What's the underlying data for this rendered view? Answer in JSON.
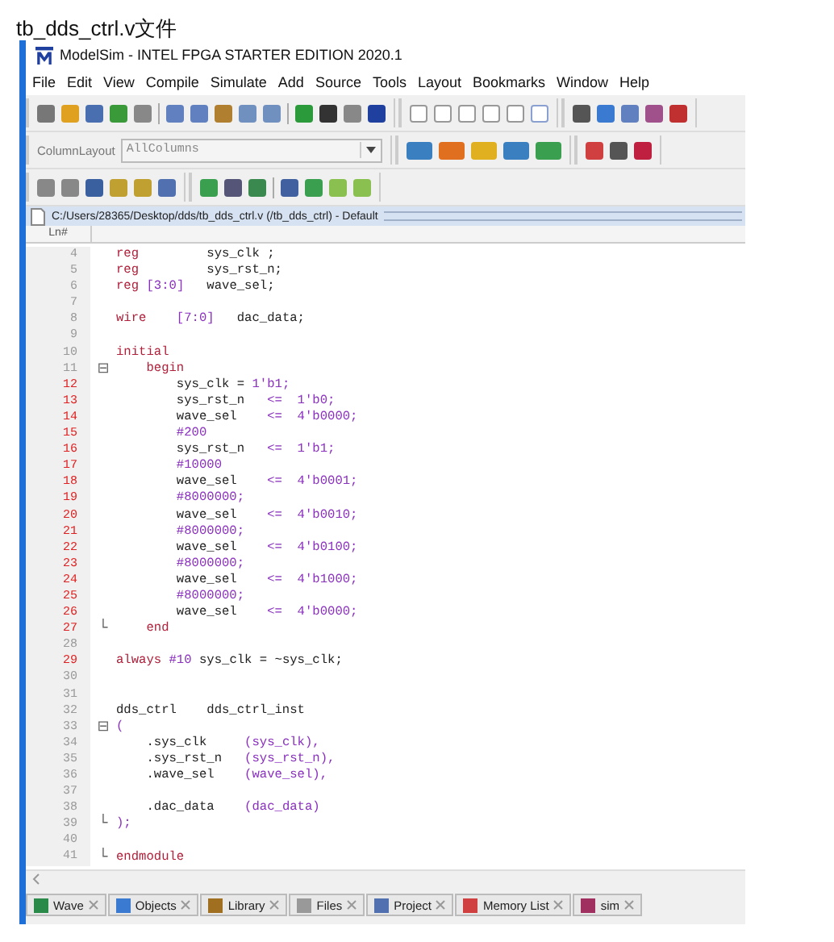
{
  "heading": "tb_dds_ctrl.v文件",
  "window": {
    "title": "ModelSim - INTEL FPGA STARTER EDITION 2020.1"
  },
  "menu": [
    "File",
    "Edit",
    "View",
    "Compile",
    "Simulate",
    "Add",
    "Source",
    "Tools",
    "Layout",
    "Bookmarks",
    "Window",
    "Help"
  ],
  "column_layout": {
    "label": "ColumnLayout",
    "value": "AllColumns"
  },
  "source": {
    "path": "C:/Users/28365/Desktop/dds/tb_dds_ctrl.v (/tb_dds_ctrl) - Default",
    "header": "Ln#",
    "lines": [
      {
        "n": "4",
        "executable": false,
        "tokens": [
          {
            "t": "reg",
            "kind": "keyword"
          },
          {
            "t": "         sys_clk ;",
            "kind": "plain"
          }
        ]
      },
      {
        "n": "5",
        "executable": false,
        "tokens": [
          {
            "t": "reg",
            "kind": "keyword"
          },
          {
            "t": "         sys_rst_n;",
            "kind": "plain"
          }
        ]
      },
      {
        "n": "6",
        "executable": false,
        "tokens": [
          {
            "t": "reg",
            "kind": "keyword"
          },
          {
            "t": " [3:0]",
            "kind": "number"
          },
          {
            "t": "   wave_sel;",
            "kind": "plain"
          }
        ]
      },
      {
        "n": "7",
        "executable": false
      },
      {
        "n": "8",
        "executable": false,
        "tokens": [
          {
            "t": "wire",
            "kind": "keyword"
          },
          {
            "t": "    [7:0]",
            "kind": "number"
          },
          {
            "t": "   dac_data;",
            "kind": "plain"
          }
        ]
      },
      {
        "n": "9",
        "executable": false
      },
      {
        "n": "10",
        "executable": false,
        "tokens": [
          {
            "t": "initial",
            "kind": "keyword"
          }
        ]
      },
      {
        "n": "11",
        "executable": false,
        "fold": "⊟",
        "tokens": [
          {
            "t": "    begin",
            "kind": "keyword"
          }
        ]
      },
      {
        "n": "12",
        "executable": true,
        "tokens": [
          {
            "t": "        sys_clk = ",
            "kind": "plain"
          },
          {
            "t": "1'b1;",
            "kind": "number"
          }
        ]
      },
      {
        "n": "13",
        "executable": true,
        "tokens": [
          {
            "t": "        sys_rst_n   ",
            "kind": "plain"
          },
          {
            "t": "<=  1'b0;",
            "kind": "number"
          }
        ]
      },
      {
        "n": "14",
        "executable": true,
        "tokens": [
          {
            "t": "        wave_sel    ",
            "kind": "plain"
          },
          {
            "t": "<=  4'b0000;",
            "kind": "number"
          }
        ]
      },
      {
        "n": "15",
        "executable": true,
        "tokens": [
          {
            "t": "        #200",
            "kind": "number"
          }
        ]
      },
      {
        "n": "16",
        "executable": true,
        "tokens": [
          {
            "t": "        sys_rst_n   ",
            "kind": "plain"
          },
          {
            "t": "<=  1'b1;",
            "kind": "number"
          }
        ]
      },
      {
        "n": "17",
        "executable": true,
        "tokens": [
          {
            "t": "        #10000",
            "kind": "number"
          }
        ]
      },
      {
        "n": "18",
        "executable": true,
        "tokens": [
          {
            "t": "        wave_sel    ",
            "kind": "plain"
          },
          {
            "t": "<=  4'b0001;",
            "kind": "number"
          }
        ]
      },
      {
        "n": "19",
        "executable": true,
        "tokens": [
          {
            "t": "        #8000000;",
            "kind": "number"
          }
        ]
      },
      {
        "n": "20",
        "executable": true,
        "tokens": [
          {
            "t": "        wave_sel    ",
            "kind": "plain"
          },
          {
            "t": "<=  4'b0010;",
            "kind": "number"
          }
        ]
      },
      {
        "n": "21",
        "executable": true,
        "tokens": [
          {
            "t": "        #8000000;",
            "kind": "number"
          }
        ]
      },
      {
        "n": "22",
        "executable": true,
        "tokens": [
          {
            "t": "        wave_sel    ",
            "kind": "plain"
          },
          {
            "t": "<=  4'b0100;",
            "kind": "number"
          }
        ]
      },
      {
        "n": "23",
        "executable": true,
        "tokens": [
          {
            "t": "        #8000000;",
            "kind": "number"
          }
        ]
      },
      {
        "n": "24",
        "executable": true,
        "tokens": [
          {
            "t": "        wave_sel    ",
            "kind": "plain"
          },
          {
            "t": "<=  4'b1000;",
            "kind": "number"
          }
        ]
      },
      {
        "n": "25",
        "executable": true,
        "tokens": [
          {
            "t": "        #8000000;",
            "kind": "number"
          }
        ]
      },
      {
        "n": "26",
        "executable": true,
        "tokens": [
          {
            "t": "        wave_sel    ",
            "kind": "plain"
          },
          {
            "t": "<=  4'b0000;",
            "kind": "number"
          }
        ]
      },
      {
        "n": "27",
        "executable": true,
        "fold": "└",
        "tokens": [
          {
            "t": "    end",
            "kind": "keyword"
          }
        ]
      },
      {
        "n": "28",
        "executable": false
      },
      {
        "n": "29",
        "executable": true,
        "tokens": [
          {
            "t": "always",
            "kind": "keyword"
          },
          {
            "t": " #10",
            "kind": "number"
          },
          {
            "t": " sys_clk = ~sys_clk;",
            "kind": "plain"
          }
        ]
      },
      {
        "n": "30",
        "executable": false
      },
      {
        "n": "31",
        "executable": false
      },
      {
        "n": "32",
        "executable": false,
        "tokens": [
          {
            "t": "dds_ctrl    dds_ctrl_inst",
            "kind": "plain"
          }
        ]
      },
      {
        "n": "33",
        "executable": false,
        "fold": "⊟",
        "tokens": [
          {
            "t": "(",
            "kind": "number"
          }
        ]
      },
      {
        "n": "34",
        "executable": false,
        "tokens": [
          {
            "t": "    .sys_clk     ",
            "kind": "plain"
          },
          {
            "t": "(sys_clk),",
            "kind": "number"
          }
        ]
      },
      {
        "n": "35",
        "executable": false,
        "tokens": [
          {
            "t": "    .sys_rst_n   ",
            "kind": "plain"
          },
          {
            "t": "(sys_rst_n),",
            "kind": "number"
          }
        ]
      },
      {
        "n": "36",
        "executable": false,
        "tokens": [
          {
            "t": "    .wave_sel    ",
            "kind": "plain"
          },
          {
            "t": "(wave_sel),",
            "kind": "number"
          }
        ]
      },
      {
        "n": "37",
        "executable": false
      },
      {
        "n": "38",
        "executable": false,
        "tokens": [
          {
            "t": "    .dac_data    ",
            "kind": "plain"
          },
          {
            "t": "(dac_data)",
            "kind": "number"
          }
        ]
      },
      {
        "n": "39",
        "executable": false,
        "fold": "└",
        "tokens": [
          {
            "t": ");",
            "kind": "number"
          }
        ]
      },
      {
        "n": "40",
        "executable": false
      },
      {
        "n": "41",
        "executable": false,
        "fold": "└",
        "tokens": [
          {
            "t": "endmodule",
            "kind": "keyword"
          }
        ]
      }
    ]
  },
  "bottom_tabs": [
    {
      "label": "Wave",
      "selected": false
    },
    {
      "label": "Objects",
      "selected": false
    },
    {
      "label": "Library",
      "selected": false
    },
    {
      "label": "Files",
      "selected": false
    },
    {
      "label": "Project",
      "selected": false
    },
    {
      "label": "Memory List",
      "selected": false
    },
    {
      "label": "sim",
      "selected": false
    }
  ]
}
